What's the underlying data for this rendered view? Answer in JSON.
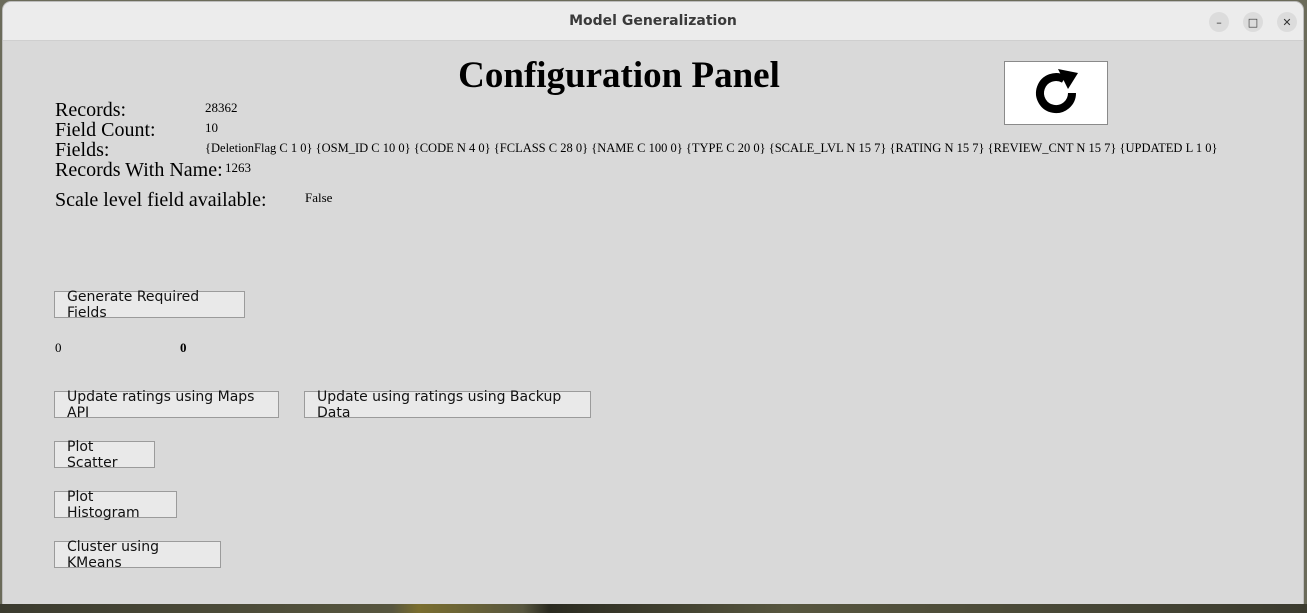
{
  "window": {
    "title": "Model Generalization",
    "controls": {
      "minimize": "–",
      "maximize": "□",
      "close": "✕"
    }
  },
  "panel": {
    "heading": "Configuration Panel",
    "refresh_icon": "refresh-icon",
    "info": {
      "records_label": "Records:",
      "records_value": "28362",
      "field_count_label": "Field Count:",
      "field_count_value": "10",
      "fields_label": "Fields:",
      "fields_value": "{DeletionFlag C 1 0} {OSM_ID C 10 0} {CODE N 4 0} {FCLASS C 28 0} {NAME C 100 0} {TYPE C 20 0} {SCALE_LVL N 15 7} {RATING N 15 7} {REVIEW_CNT N 15 7} {UPDATED L 1 0}",
      "records_with_name_label": "Records With Name:",
      "records_with_name_value": "1263",
      "scale_level_label": "Scale level field available:",
      "scale_level_value": "False"
    },
    "generate_button": "Generate Required Fields",
    "progress_left": "0",
    "progress_right": "0",
    "update_maps_button": "Update ratings using Maps API",
    "update_backup_button": "Update using ratings using Backup Data",
    "plot_scatter_button": "Plot Scatter",
    "plot_histogram_button": "Plot Histogram",
    "cluster_button": "Cluster using KMeans"
  }
}
